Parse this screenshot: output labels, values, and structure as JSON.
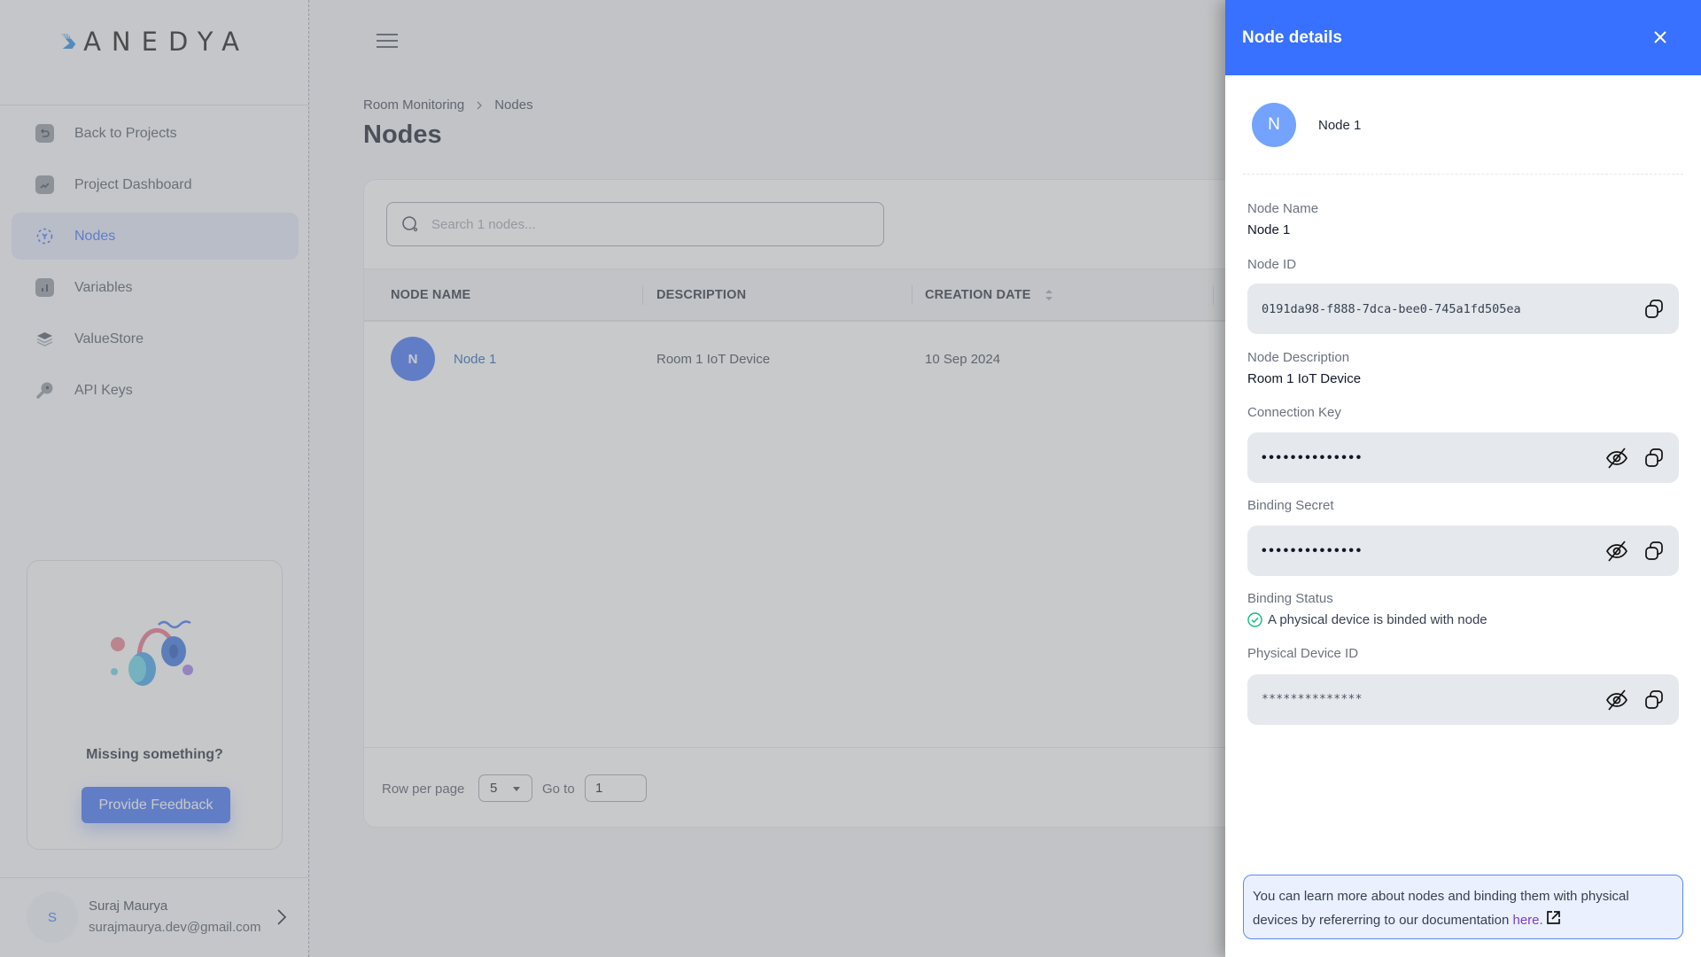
{
  "app": {
    "brand": "ANEDYA"
  },
  "sidebar": {
    "items": [
      {
        "label": "Back to Projects",
        "icon": "back-arrow-icon",
        "active": false
      },
      {
        "label": "Project Dashboard",
        "icon": "trend-chart-icon",
        "active": false
      },
      {
        "label": "Nodes",
        "icon": "nodes-icon",
        "active": true
      },
      {
        "label": "Variables",
        "icon": "bar-chart-icon",
        "active": false
      },
      {
        "label": "ValueStore",
        "icon": "layers-icon",
        "active": false
      },
      {
        "label": "API Keys",
        "icon": "key-icon",
        "active": false
      }
    ],
    "feedback": {
      "title": "Missing something?",
      "button_label": "Provide Feedback"
    },
    "user": {
      "initial": "S",
      "name": "Suraj Maurya",
      "email": "surajmaurya.dev@gmail.com"
    }
  },
  "main": {
    "breadcrumb": {
      "parent": "Room Monitoring",
      "current": "Nodes"
    },
    "title": "Nodes",
    "search": {
      "placeholder": "Search 1 nodes...",
      "value": ""
    },
    "table": {
      "columns": [
        "NODE NAME",
        "DESCRIPTION",
        "CREATION DATE"
      ],
      "rows": [
        {
          "initial": "N",
          "name": "Node 1",
          "description": "Room 1 IoT Device",
          "created": "10 Sep 2024"
        }
      ]
    },
    "pagination": {
      "rows_per_page_label": "Row per page",
      "rows_per_page": "5",
      "goto_label": "Go to",
      "goto_value": "1"
    }
  },
  "drawer": {
    "title": "Node details",
    "node_initial": "N",
    "node_name": "Node 1",
    "fields": {
      "node_name_label": "Node Name",
      "node_name_value": "Node 1",
      "node_id_label": "Node ID",
      "node_id_value": "0191da98-f888-7dca-bee0-745a1fd505ea",
      "description_label": "Node Description",
      "description_value": "Room 1 IoT Device",
      "connection_key_label": "Connection Key",
      "connection_key_masked": "••••••••••••••",
      "binding_secret_label": "Binding Secret",
      "binding_secret_masked": "••••••••••••••",
      "binding_status_label": "Binding Status",
      "binding_status_value": "A physical device is binded with node",
      "physical_device_id_label": "Physical Device ID",
      "physical_device_id_masked": "**************"
    },
    "info": {
      "text": "You can learn more about nodes and binding them with physical devices by refererring to our documentation ",
      "link_label": "here."
    }
  },
  "colors": {
    "accent": "#3870ff",
    "status_ok": "#10b981",
    "link": "#7b3ec9"
  }
}
